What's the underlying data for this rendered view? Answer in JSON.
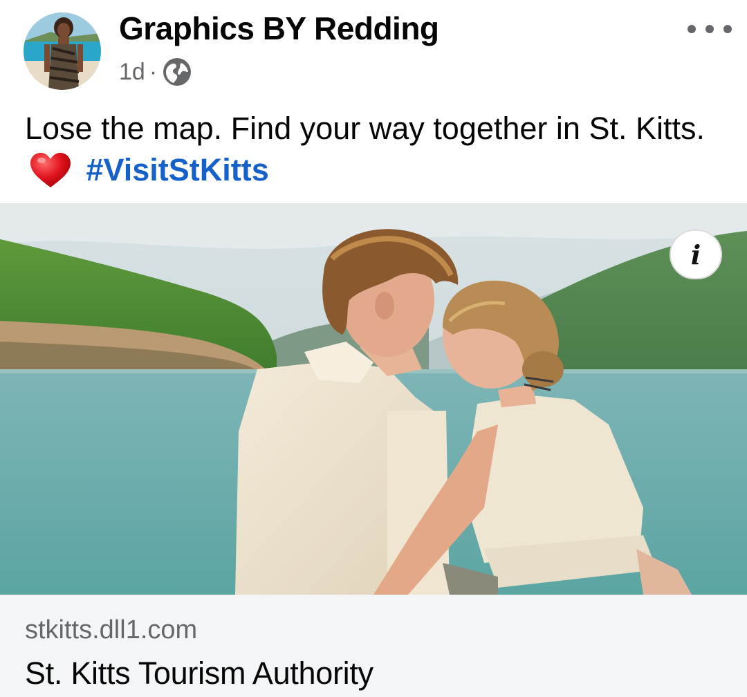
{
  "post": {
    "author": "Graphics BY Redding",
    "time": "1d",
    "separator": "·",
    "privacy_icon": "globe-icon",
    "more_icon": "more-dots-icon",
    "caption_text": "Lose the map. Find your way together in St. Kitts.",
    "caption_emoji_icon": "red-heart-icon",
    "hashtag": "#VisitStKitts"
  },
  "ad": {
    "info_label": "i",
    "link_domain": "stkitts.dll1.com",
    "link_title": "St. Kitts Tourism Authority"
  },
  "colors": {
    "hashtag": "#1660c9",
    "meta_text": "#65676b",
    "card_bg": "#f4f5f7"
  }
}
